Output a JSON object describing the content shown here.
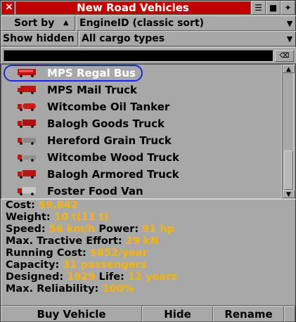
{
  "window": {
    "close_glyph": "×",
    "title": "New Road Vehicles",
    "collapse_glyph": "☰",
    "shade_glyph": "■",
    "sticky_glyph": "✦"
  },
  "sort": {
    "label": "Sort by",
    "direction_glyph": "▲",
    "value": "EngineID (classic sort)",
    "dropdown_glyph": "▼"
  },
  "filter": {
    "hidden_label": "Show hidden",
    "cargo_value": "All cargo types",
    "dropdown_glyph": "▼"
  },
  "search": {
    "value": "",
    "clear_glyph": "⌫"
  },
  "vehicles": [
    {
      "name": "MPS Regal Bus",
      "icon": "bus-icon",
      "selected": true
    },
    {
      "name": "MPS Mail Truck",
      "icon": "mail-truck-icon"
    },
    {
      "name": "Witcombe Oil Tanker",
      "icon": "oil-tanker-icon"
    },
    {
      "name": "Balogh Goods Truck",
      "icon": "goods-truck-icon"
    },
    {
      "name": "Hereford Grain Truck",
      "icon": "grain-truck-icon"
    },
    {
      "name": "Witcombe Wood Truck",
      "icon": "wood-truck-icon"
    },
    {
      "name": "Balogh Armored Truck",
      "icon": "armored-truck-icon"
    },
    {
      "name": "Foster Food Van",
      "icon": "food-van-icon"
    }
  ],
  "scrollbar": {
    "up_glyph": "▲",
    "down_glyph": "▼"
  },
  "details": {
    "cost_label": "Cost:",
    "cost": "$9,842",
    "weight_label": "Weight:",
    "weight": "10 t(11 t)",
    "speed_label": "Speed:",
    "speed": "56 km/h",
    "power_label": "Power:",
    "power": "91 hp",
    "tractive_label": "Max. Tractive Effort:",
    "tractive": "29 kN",
    "running_label": "Running Cost:",
    "running": "$852/year",
    "capacity_label": "Capacity:",
    "capacity": "31 passengers",
    "designed_label": "Designed:",
    "designed": "1929",
    "life_label": "Life:",
    "life": "12 years",
    "reliability_label": "Max. Reliability:",
    "reliability": "100%"
  },
  "buttons": {
    "buy": "Buy Vehicle",
    "hide": "Hide",
    "rename": "Rename"
  },
  "colors": {
    "title_bg": "#c00000",
    "value_text": "#f8b400",
    "selection_outline": "#1a2ad8",
    "panel": "#a8a8a8"
  }
}
